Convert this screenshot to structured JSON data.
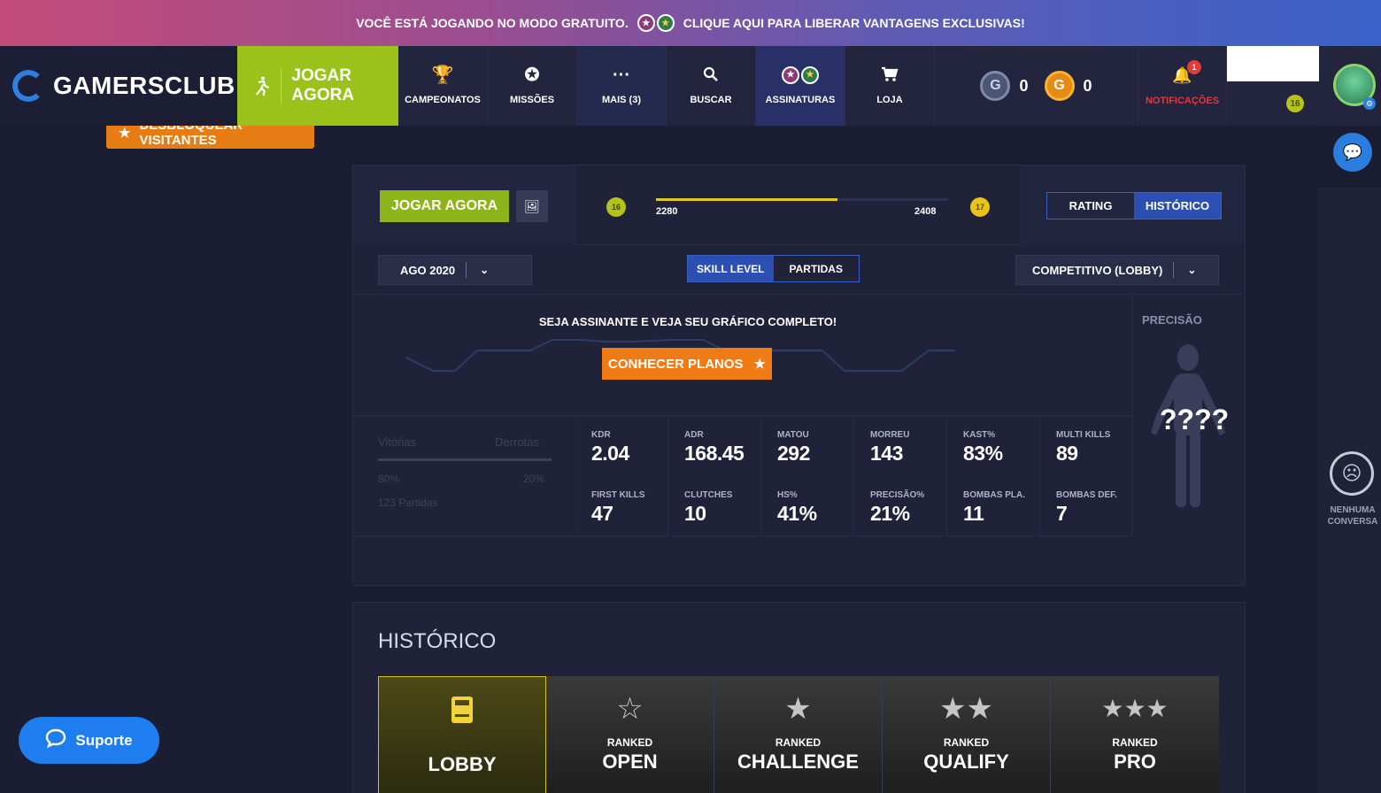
{
  "promo": {
    "text_left": "VOCÊ ESTÁ JOGANDO NO MODO GRATUITO.",
    "text_right": "CLIQUE AQUI PARA LIBERAR VANTAGENS EXCLUSIVAS!"
  },
  "nav": {
    "logo": "GAMERSCLUB",
    "play_now": "JOGAR AGORA",
    "items": [
      {
        "label": "CAMPEONATOS",
        "icon": "trophy-icon"
      },
      {
        "label": "MISSÕES",
        "icon": "medal-icon"
      },
      {
        "label": "MAIS (3)",
        "icon": "more-dots-icon"
      },
      {
        "label": "BUSCAR",
        "icon": "search-icon"
      },
      {
        "label": "ASSINATURAS",
        "icon": "subscription-badges-icon"
      },
      {
        "label": "LOJA",
        "icon": "cart-icon"
      }
    ],
    "silver_coins": "0",
    "gold_coins": "0",
    "notifications_label": "NOTIFICAÇÕES",
    "notifications_count": "1",
    "user_level": "16"
  },
  "unlock_visitors": "DESBLOQUEAR VISITANTES",
  "card": {
    "play_now": "JOGAR AGORA",
    "level_current": "16",
    "level_next": "17",
    "rating_min": "2280",
    "rating_max": "2408",
    "progress_fraction": 0.62,
    "toggle": [
      "RATING",
      "HISTÓRICO"
    ],
    "month": "AGO 2020",
    "segment": [
      "SKILL LEVEL",
      "PARTIDAS"
    ],
    "mode": "COMPETITIVO (LOBBY)",
    "cta_title": "SEJA ASSINANTE E VEJA SEU GRÁFICO COMPLETO!",
    "cta_button": "CONHECER PLANOS",
    "precision_label": "PRECISÃO",
    "precision_unknown": "????",
    "winrate": {
      "wins": "Vitórias",
      "losses": "Derrotas",
      "win_pct": "80%",
      "loss_pct": "20%",
      "matches": "123 Partidas"
    },
    "stats": [
      {
        "label": "KDR",
        "value": "2.04"
      },
      {
        "label": "ADR",
        "value": "168.45"
      },
      {
        "label": "MATOU",
        "value": "292"
      },
      {
        "label": "MORREU",
        "value": "143"
      },
      {
        "label": "KAST%",
        "value": "83%"
      },
      {
        "label": "MULTI KILLS",
        "value": "89"
      },
      {
        "label": "FIRST KILLS",
        "value": "47"
      },
      {
        "label": "CLUTCHES",
        "value": "10"
      },
      {
        "label": "HS%",
        "value": "41%"
      },
      {
        "label": "PRECISÃO%",
        "value": "21%"
      },
      {
        "label": "BOMBAS PLA.",
        "value": "11"
      },
      {
        "label": "BOMBAS DEF.",
        "value": "7"
      }
    ]
  },
  "history": {
    "title": "HISTÓRICO",
    "tiles": [
      {
        "sub": "",
        "main": "LOBBY",
        "icon": "lobby-card-icon"
      },
      {
        "sub": "RANKED",
        "main": "OPEN",
        "icon": "star-outline-icon"
      },
      {
        "sub": "RANKED",
        "main": "CHALLENGE",
        "icon": "star-icon"
      },
      {
        "sub": "RANKED",
        "main": "QUALIFY",
        "icon": "two-stars-icon"
      },
      {
        "sub": "RANKED",
        "main": "PRO",
        "icon": "three-stars-icon"
      }
    ]
  },
  "rail": {
    "no_chat": "NENHUMA CONVERSA"
  },
  "support": "Suporte"
}
